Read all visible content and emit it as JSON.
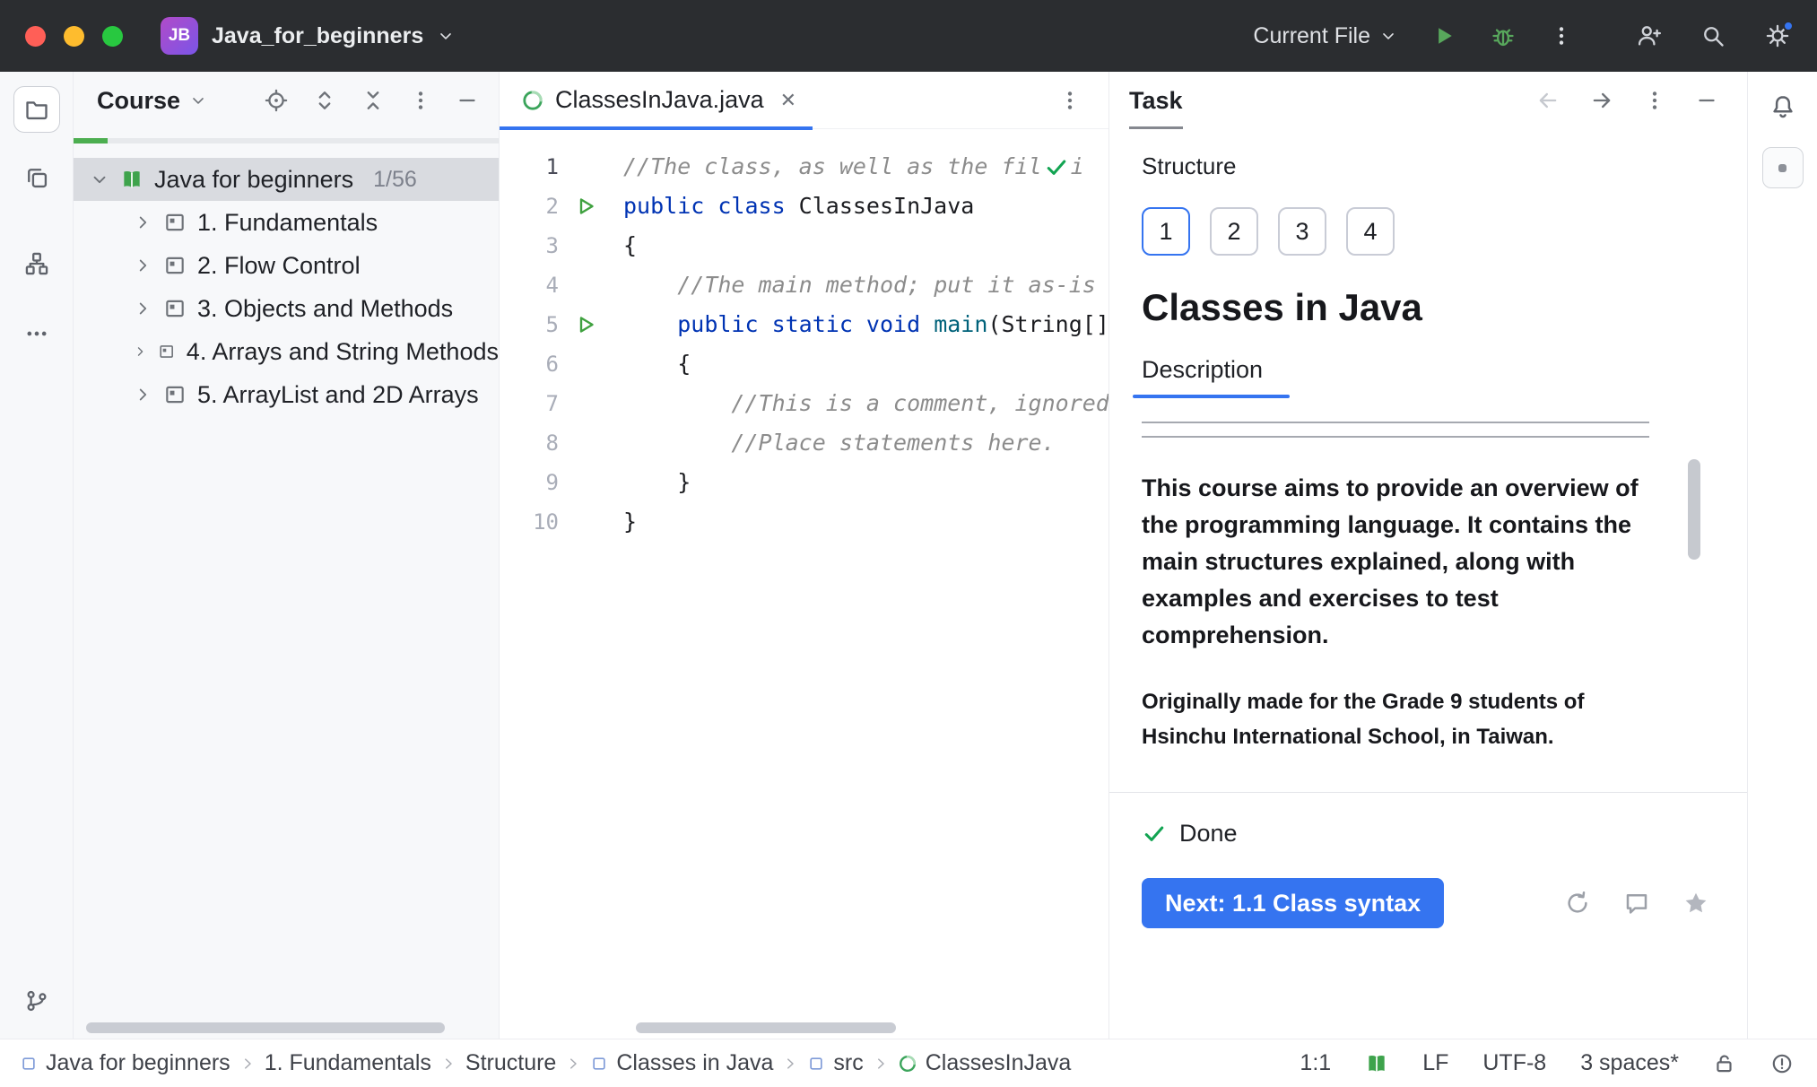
{
  "titlebar": {
    "project_initials": "JB",
    "project_name": "Java_for_beginners",
    "run_config": "Current File"
  },
  "course_panel": {
    "title": "Course",
    "root": {
      "label": "Java for beginners",
      "badge": "1/56"
    },
    "items": [
      "1. Fundamentals",
      "2. Flow Control",
      "3. Objects and Methods",
      "4. Arrays and String Methods",
      "5. ArrayList and 2D Arrays"
    ]
  },
  "editor": {
    "tab_title": "ClassesInJava.java",
    "code": [
      {
        "num": "1",
        "segments": [
          {
            "t": "//The class, as well as the fil"
          },
          {
            "t": "i"
          }
        ]
      },
      {
        "num": "2",
        "segments": [
          {
            "t": "public class "
          },
          {
            "t": "ClassesInJava"
          }
        ]
      },
      {
        "num": "3",
        "segments": [
          {
            "t": "{"
          }
        ]
      },
      {
        "num": "4",
        "segments": [
          {
            "t": "    "
          },
          {
            "t": "//The main method; put it as-is"
          }
        ]
      },
      {
        "num": "5",
        "segments": [
          {
            "t": "    "
          },
          {
            "t": "public static void "
          },
          {
            "t": "main"
          },
          {
            "t": "(String[]"
          }
        ]
      },
      {
        "num": "6",
        "segments": [
          {
            "t": "    {"
          }
        ]
      },
      {
        "num": "7",
        "segments": [
          {
            "t": "        "
          },
          {
            "t": "//This is a comment, ignored"
          }
        ]
      },
      {
        "num": "8",
        "segments": [
          {
            "t": "        "
          },
          {
            "t": "//Place statements here."
          }
        ]
      },
      {
        "num": "9",
        "segments": [
          {
            "t": "    }"
          }
        ]
      },
      {
        "num": "10",
        "segments": [
          {
            "t": "}"
          }
        ]
      }
    ]
  },
  "task_panel": {
    "title": "Task",
    "section_label": "Structure",
    "steps": [
      "1",
      "2",
      "3",
      "4"
    ],
    "active_step": "1",
    "heading": "Classes in Java",
    "tab": "Description",
    "paragraph": "This course aims to provide an overview of the programming language. It contains the main structures explained, along with examples and exercises to test comprehension.",
    "note": "Originally made for the Grade 9 students of Hsinchu International School, in Taiwan.",
    "done_label": "Done",
    "next_button": "Next: 1.1 Class syntax"
  },
  "statusbar": {
    "breadcrumbs": [
      "Java for beginners",
      "1. Fundamentals",
      "Structure",
      "Classes in Java",
      "src",
      "ClassesInJava"
    ],
    "caret_position": "1:1",
    "line_separator": "LF",
    "encoding": "UTF-8",
    "indent": "3 spaces*"
  },
  "colors": {
    "accent_blue": "#3574F0",
    "run_green": "#3FA13F",
    "done_green": "#12A452",
    "keyword_blue": "#0033B3",
    "comment_gray": "#8C8C8C"
  }
}
